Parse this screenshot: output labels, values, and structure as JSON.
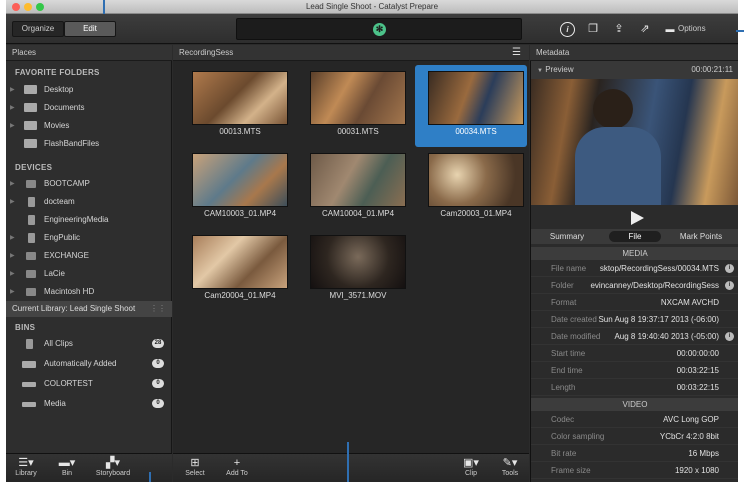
{
  "window": {
    "title": "Lead Single Shoot - Catalyst Prepare"
  },
  "toolbar": {
    "organize_label": "Organize",
    "edit_label": "Edit",
    "options_label": "Options"
  },
  "places": {
    "header": "Places",
    "favorites_title": "FAVORITE FOLDERS",
    "favorites": [
      "Desktop",
      "Documents",
      "Movies",
      "FlashBandFiles"
    ],
    "devices_title": "DEVICES",
    "devices": [
      "BOOTCAMP",
      "docteam",
      "EngineeringMedia",
      "EngPublic",
      "EXCHANGE",
      "LaCie",
      "Macintosh HD"
    ]
  },
  "library": {
    "current": "Current Library: Lead Single Shoot",
    "bins_title": "BINS",
    "bins": [
      {
        "label": "All Clips",
        "count": "28"
      },
      {
        "label": "Automatically Added",
        "count": "0"
      },
      {
        "label": "COLORTEST",
        "count": "0"
      },
      {
        "label": "Media",
        "count": "0"
      }
    ]
  },
  "left_bottom": {
    "library": "Library",
    "bin": "Bin",
    "storyboard": "Storyboard"
  },
  "grid": {
    "header": "RecordingSess",
    "clips": [
      "00013.MTS",
      "00031.MTS",
      "00034.MTS",
      "CAM10003_01.MP4",
      "CAM10004_01.MP4",
      "Cam20003_01.MP4",
      "Cam20004_01.MP4",
      "MVI_3571.MOV"
    ],
    "selected_index": 2
  },
  "grid_bottom": {
    "select": "Select",
    "add_to": "Add To",
    "clip": "Clip",
    "tools": "Tools"
  },
  "metadata": {
    "header": "Metadata",
    "preview_label": "Preview",
    "timecode": "00:00:21:11",
    "tabs": [
      "Summary",
      "File",
      "Mark Points"
    ],
    "active_tab": "File",
    "media_title": "MEDIA",
    "media": [
      {
        "k": "File name",
        "v": "sktop/RecordingSess/00034.MTS"
      },
      {
        "k": "Folder",
        "v": "evincanney/Desktop/RecordingSess"
      },
      {
        "k": "Format",
        "v": "NXCAM AVCHD"
      },
      {
        "k": "Date created",
        "v": "Sun Aug  8 19:37:17 2013 (-06:00)"
      },
      {
        "k": "Date modified",
        "v": "Aug  8 19:40:40 2013 (-05:00)"
      },
      {
        "k": "Start time",
        "v": "00:00:00:00"
      },
      {
        "k": "End time",
        "v": "00:03:22:15"
      },
      {
        "k": "Length",
        "v": "00:03:22:15"
      }
    ],
    "video_title": "VIDEO",
    "video": [
      {
        "k": "Codec",
        "v": "AVC Long GOP"
      },
      {
        "k": "Color sampling",
        "v": "YCbCr 4:2:0 8bit"
      },
      {
        "k": "Bit rate",
        "v": "16 Mbps"
      },
      {
        "k": "Frame size",
        "v": "1920 x 1080"
      }
    ]
  },
  "colors": {
    "accent": "#2f7fc6",
    "brand": "#4cc38a"
  }
}
